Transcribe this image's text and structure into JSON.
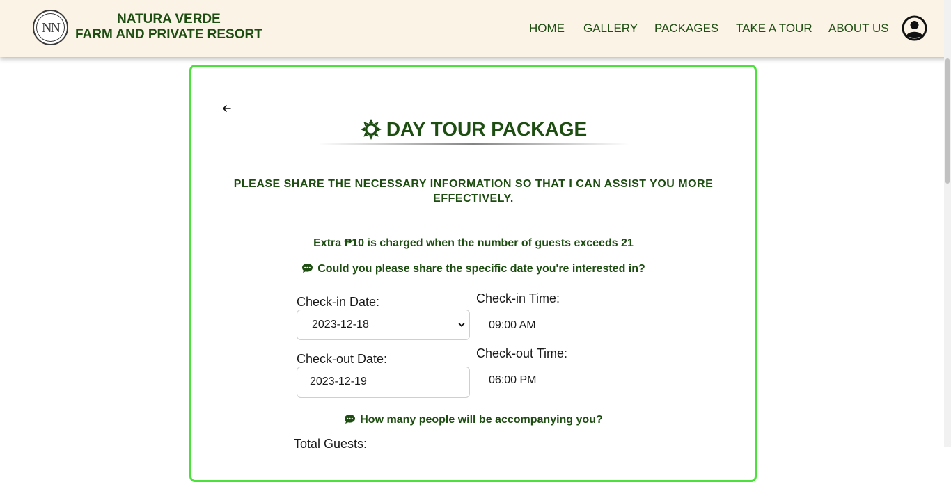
{
  "header": {
    "brand_line1": "NATURA VERDE",
    "brand_line2": "FARM AND PRIVATE RESORT",
    "logo_monogram": "NN",
    "nav": [
      "HOME",
      "GALLERY",
      "PACKAGES",
      "TAKE A TOUR",
      "ABOUT US"
    ]
  },
  "page": {
    "title": "DAY TOUR PACKAGE",
    "intro": "PLEASE SHARE THE NECESSARY INFORMATION SO THAT I CAN ASSIST YOU MORE EFFECTIVELY.",
    "extra_note": "Extra ₱10 is charged when the number of guests exceeds 21",
    "question_date": "Could you please share the specific date you're interested in?",
    "question_people": "How many people will be accompanying you?"
  },
  "form": {
    "checkin_date_label": "Check-in Date:",
    "checkin_date_value": "2023-12-18",
    "checkout_date_label": "Check-out Date:",
    "checkout_date_value": "2023-12-19",
    "checkin_time_label": "Check-in Time:",
    "checkin_time_value": "09:00 AM",
    "checkout_time_label": "Check-out Time:",
    "checkout_time_value": "06:00 PM",
    "total_guests_label": "Total Guests:"
  },
  "icons": {
    "title_icon": "sun-icon",
    "question_icon": "comment-dots-icon",
    "back": "arrow-left-icon",
    "user": "user-circle-icon"
  },
  "colors": {
    "brand_green": "#1d4d10",
    "card_border": "#4ce13a",
    "header_bg": "#faf3e6"
  }
}
